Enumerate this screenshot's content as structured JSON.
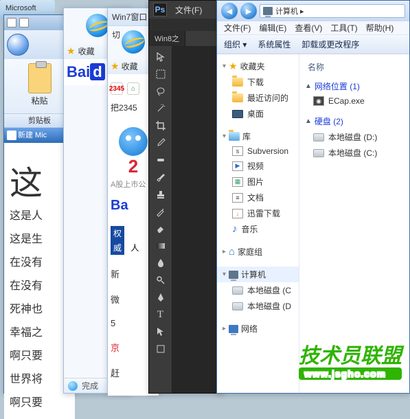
{
  "notepad": {
    "title": "Microsoft"
  },
  "word": {
    "paste": "粘贴",
    "clipboard": "剪贴板",
    "tab_prefix": "新建 Mic",
    "big": "这",
    "lines": [
      "这是人",
      "这是生",
      "在没有",
      "在没有",
      "死神也",
      "幸福之",
      "啊只要",
      "世界将",
      "啊只要"
    ]
  },
  "ie1": {
    "fav": "收藏",
    "done": "完成",
    "baidu_a": "Bai",
    "baidu_b": "d"
  },
  "ie2": {
    "tab": "Win7窗口切",
    "fav": "收藏",
    "fav_site": "2345",
    "fav_hint": "把2345",
    "octo_num": "2",
    "caption": "A股上市公",
    "baidu": "Ba",
    "chip_a": "权",
    "chip_b": "威",
    "chip_txt": "人",
    "l1": "新",
    "l2": "微",
    "l3": "5",
    "l4": "京",
    "l5": "赶"
  },
  "ps": {
    "logo": "Ps",
    "menu": "文件(F)",
    "tab": "Win8之"
  },
  "explorer": {
    "path": "计算机 ▸",
    "menus": [
      "文件(F)",
      "编辑(E)",
      "查看(V)",
      "工具(T)",
      "帮助(H)"
    ],
    "cmds": [
      "组织 ▾",
      "系统属性",
      "卸载或更改程序"
    ],
    "side": {
      "fav": "收藏夹",
      "fav_items": [
        "下载",
        "最近访问的",
        "桌面"
      ],
      "lib": "库",
      "lib_items": [
        "Subversion",
        "视频",
        "图片",
        "文档",
        "迅雷下载",
        "音乐"
      ],
      "home": "家庭组",
      "pc": "计算机",
      "pc_items": [
        "本地磁盘 (C",
        "本地磁盘 (D"
      ],
      "net": "网络"
    },
    "main": {
      "col": "名称",
      "g1": "网络位置 (1)",
      "g1_item": "ECap.exe",
      "g2": "硬盘 (2)",
      "g2_items": [
        "本地磁盘 (D:)",
        "本地磁盘 (C:)"
      ]
    }
  },
  "wm": {
    "text": "技术员联盟",
    "url": "www.jsgho.com"
  }
}
